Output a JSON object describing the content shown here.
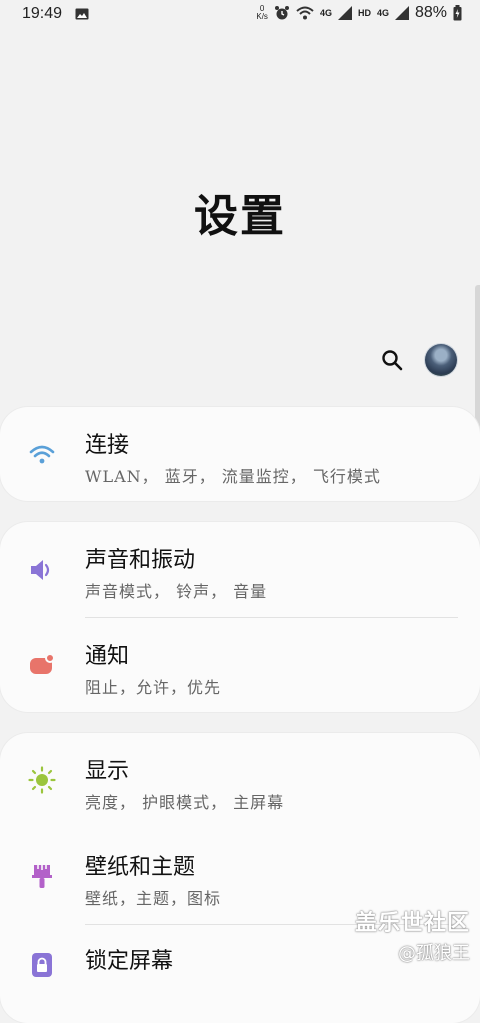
{
  "status_bar": {
    "time": "19:49",
    "speed_value": "0",
    "speed_unit": "K/s",
    "net_4g_1": "4G",
    "hd": "HD",
    "net_4g_2": "4G",
    "battery": "88%",
    "icons": [
      "image-icon",
      "alarm-icon",
      "wifi-icon",
      "signal-icon",
      "signal-icon",
      "battery-icon"
    ]
  },
  "page_title": "设置",
  "header_icons": [
    "search-icon",
    "avatar"
  ],
  "cards": [
    {
      "items": [
        {
          "title": "连接",
          "subtitle": "WLAN， 蓝牙， 流量监控， 飞行模式",
          "icon": "wifi-icon",
          "color": "#5aa0d8"
        }
      ]
    },
    {
      "items": [
        {
          "title": "声音和振动",
          "subtitle": "声音模式， 铃声， 音量",
          "icon": "speaker-icon",
          "color": "#8a74d6"
        },
        {
          "title": "通知",
          "subtitle": "阻止，允许，优先",
          "icon": "notification-icon",
          "color": "#e8746a"
        }
      ]
    },
    {
      "items": [
        {
          "title": "显示",
          "subtitle": "亮度， 护眼模式， 主屏幕",
          "icon": "brightness-icon",
          "color": "#9bc53d"
        },
        {
          "title": "壁纸和主题",
          "subtitle": "壁纸，主题，图标",
          "icon": "brush-icon",
          "color": "#b361c9"
        },
        {
          "title": "锁定屏幕",
          "subtitle": "",
          "icon": "lock-icon",
          "color": "#8a74d6"
        }
      ]
    }
  ],
  "watermark": {
    "main": "盖乐世社区",
    "sub": "@孤狼王"
  }
}
